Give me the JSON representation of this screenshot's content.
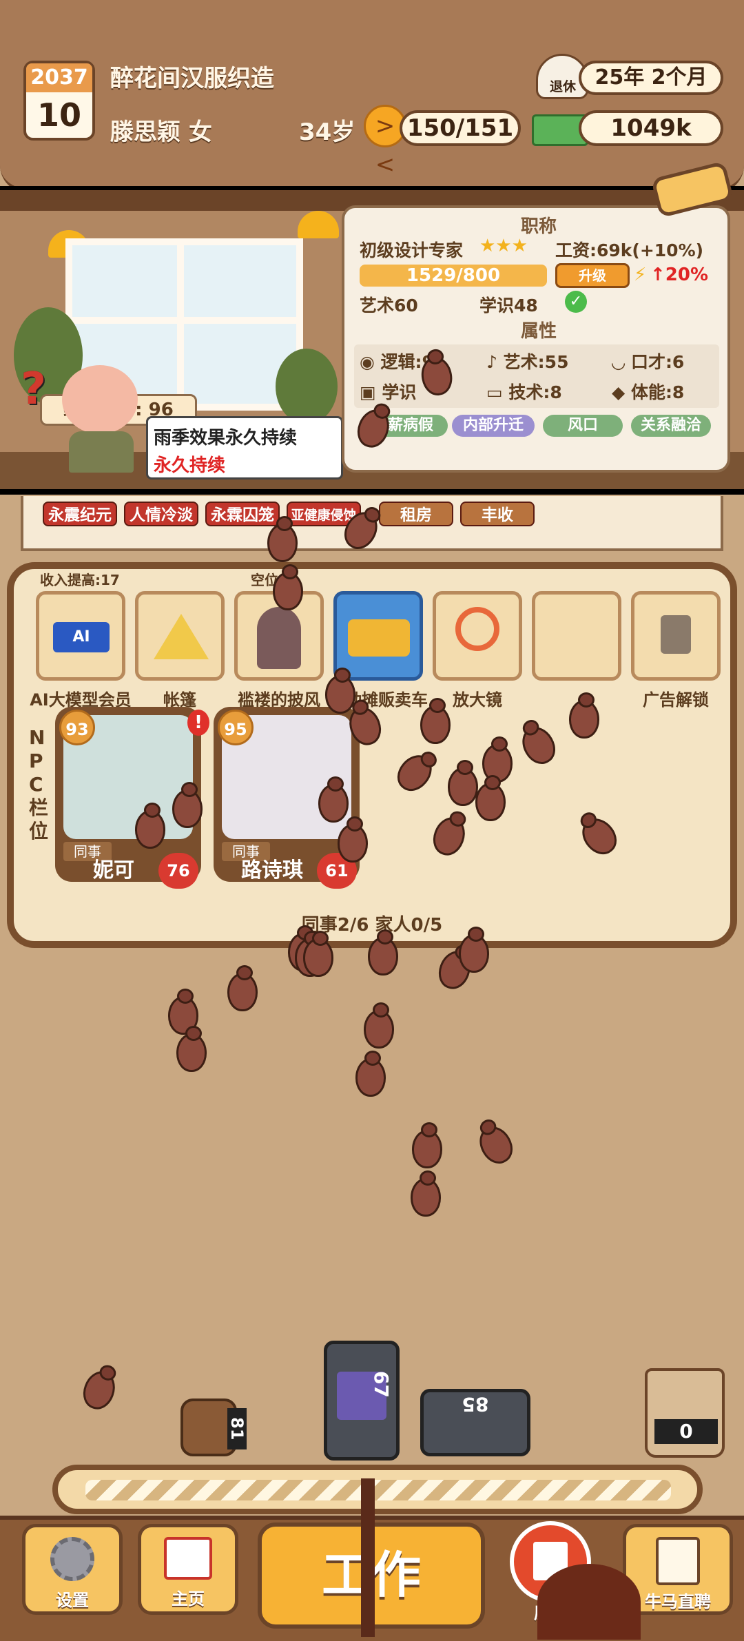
{
  "header": {
    "year": "2037",
    "month": "10",
    "company": "醉花间汉服织造",
    "name_gender": "滕思颖 女",
    "age": "34岁",
    "energy": "150/151",
    "money": "1049k",
    "retire_label": "退休",
    "retire_time": "25年 2个月"
  },
  "scene": {
    "performance": "绩效评分: 96",
    "speech_line1": "雨季效果永久持续",
    "speech_line2": "永久持续"
  },
  "job": {
    "title": "职称",
    "rank": "初级设计专家",
    "salary": "工资:69k(+10%)",
    "progress_text": "1529/800",
    "progress_fraction": 1.0,
    "upgrade_label": "升级",
    "boost": "↑20%",
    "req_art": "艺术60",
    "req_knowledge": "学识48",
    "attr_title": "属性",
    "attr_logic": "逻辑:9",
    "attr_art": "艺术:55",
    "attr_eloquence": "口才:6",
    "attr_knowledge": "学识",
    "attr_tech": "技术:8",
    "attr_stamina": "体能:8",
    "tag_1": "薪病假",
    "tag_2": "内部升迁",
    "tag_3": "风口",
    "tag_4": "关系融洽"
  },
  "events": [
    "永震纪元",
    "人情冷淡",
    "永霖囚笼",
    "亚健康侵蚀",
    "租房",
    "丰收"
  ],
  "items": {
    "income_label": "收入提高:17",
    "empty_label": "空位",
    "slots": [
      "AI大模型会员",
      "帐篷",
      "褴褛的披风",
      "流动摊贩卖车",
      "放大镜",
      "",
      "广告解锁"
    ],
    "ai_badge": "AI"
  },
  "npc": {
    "side_label": [
      "N",
      "P",
      "C",
      "栏",
      "位"
    ],
    "cards": [
      {
        "level": "93",
        "role": "同事",
        "name": "妮可",
        "affinity": "76"
      },
      {
        "level": "95",
        "role": "同事",
        "name": "路诗琪",
        "affinity": "61"
      }
    ],
    "summary": "同事2/6 家人0/5"
  },
  "floor_items": {
    "barrel_value": "81",
    "console_value": "67",
    "toolbox_value": "85",
    "bag_value": "0"
  },
  "nav": {
    "settings": "设置",
    "home": "主页",
    "work": "工作",
    "original": "原创",
    "hire": "牛马直聘"
  }
}
